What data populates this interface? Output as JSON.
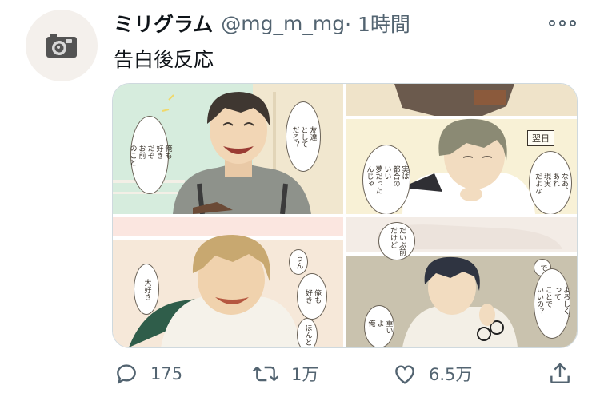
{
  "tweet": {
    "author_name": "ミリグラム",
    "handle": "@mg_m_mg",
    "time": " · 1時間",
    "text": "告白後反応"
  },
  "media": {
    "panel1": {
      "bubble_a": "友達\nとして\nだろ？",
      "bubble_b": "俺も\n好き\nだぞ\nお前\nのこと"
    },
    "panel2": {
      "date_tag": "翌日",
      "bubble_a": "実は\n都合の\nいい\n夢だった\nんじゃ",
      "bubble_b": "なあ、\nあれ\n現実\nだよな"
    },
    "panel3": {
      "bubble_a": "大好き",
      "bubble_b": "うん",
      "bubble_c": "俺も\n好き",
      "bubble_d": "ほんと"
    },
    "panel4": {
      "bubble_a": "だいぶ前\nだけど",
      "bubble_b": "で",
      "bubble_c": "よろしく、\nって\nことで\nいいの？",
      "bubble_d": "重い\nよ\n俺"
    }
  },
  "actions": {
    "reply_count": "175",
    "retweet_count": "1万",
    "like_count": "6.5万"
  },
  "colors": {
    "icon_gray": "#536471",
    "text": "#0f1419"
  },
  "icons": [
    "camera-icon",
    "more-icon",
    "reply-icon",
    "retweet-icon",
    "like-icon",
    "share-icon"
  ]
}
